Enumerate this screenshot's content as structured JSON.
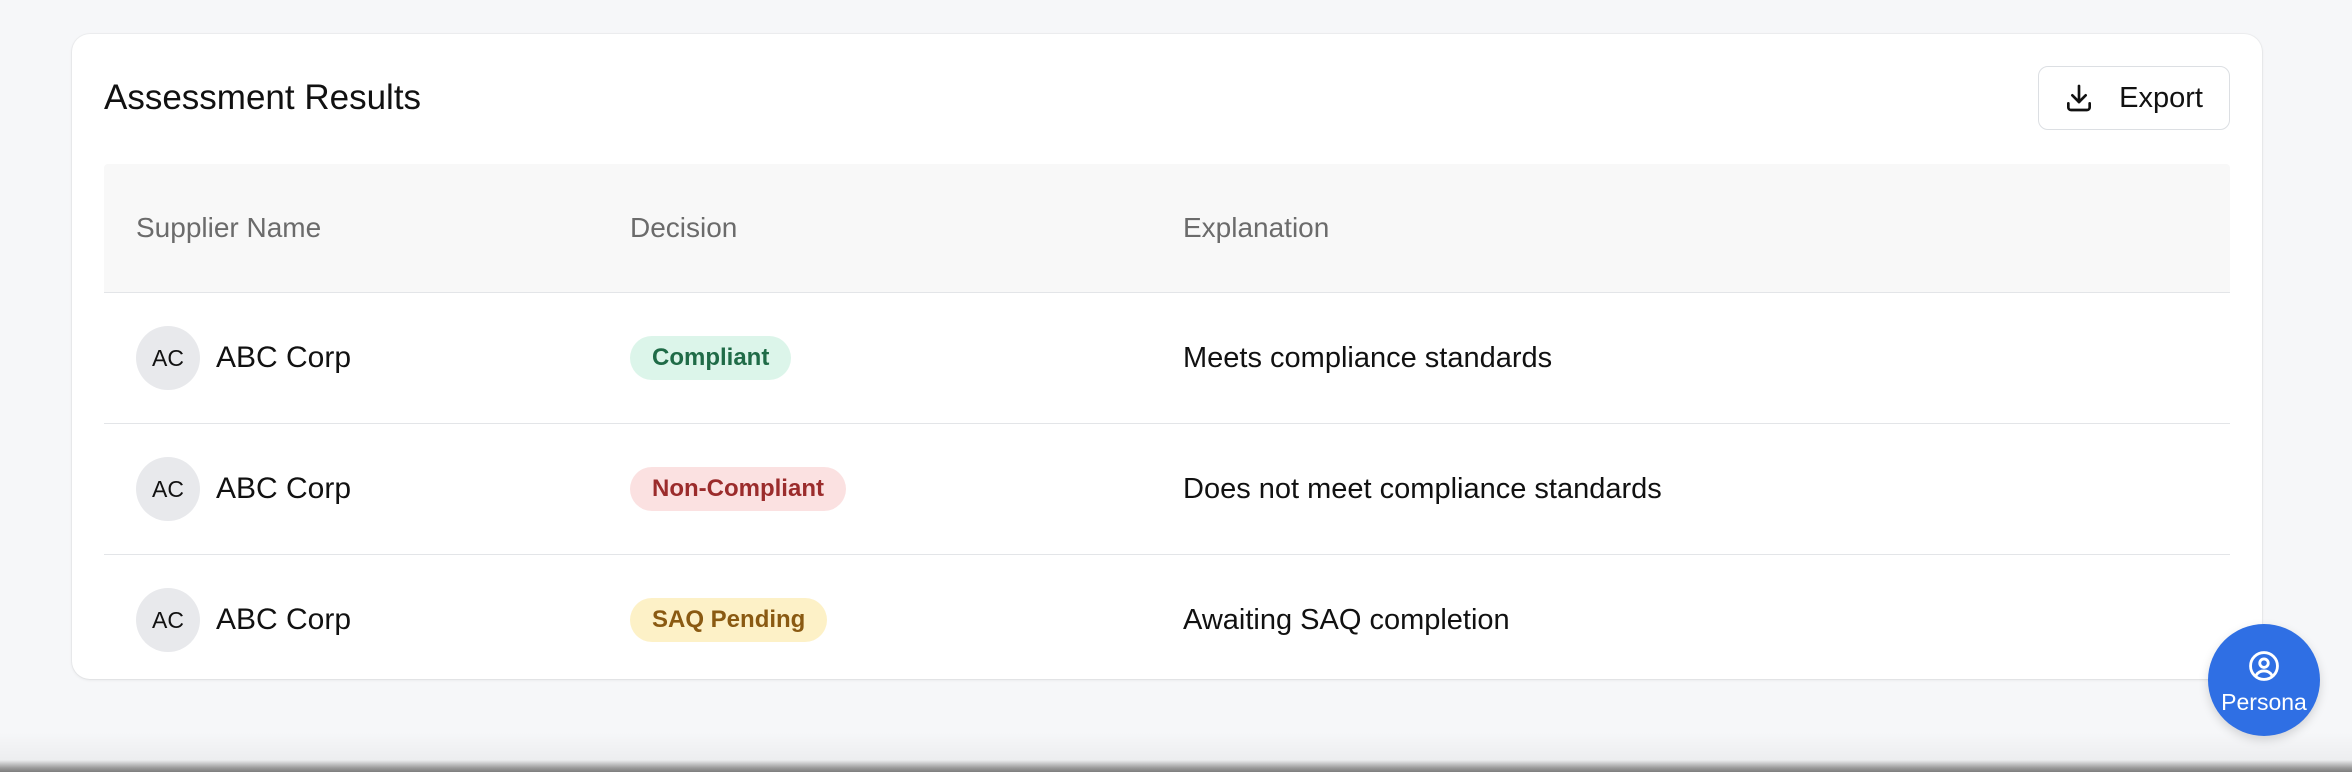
{
  "card": {
    "title": "Assessment Results",
    "export_label": "Export"
  },
  "table": {
    "headers": [
      "Supplier Name",
      "Decision",
      "Explanation"
    ],
    "rows": [
      {
        "avatar": "AC",
        "supplier": "ABC Corp",
        "decision": "Compliant",
        "decision_status": "compliant",
        "explanation": "Meets compliance standards"
      },
      {
        "avatar": "AC",
        "supplier": "ABC Corp",
        "decision": "Non-Compliant",
        "decision_status": "non-compliant",
        "explanation": "Does not meet compliance standards"
      },
      {
        "avatar": "AC",
        "supplier": "ABC Corp",
        "decision": "SAQ Pending",
        "decision_status": "pending",
        "explanation": "Awaiting SAQ completion"
      }
    ]
  },
  "badge_colors": {
    "compliant": {
      "bg": "#dcf5ea",
      "fg": "#1f6b47"
    },
    "non-compliant": {
      "bg": "#fbe1e1",
      "fg": "#9b2c2c"
    },
    "pending": {
      "bg": "#fdf1c7",
      "fg": "#8a5a12"
    }
  },
  "persona": {
    "label": "Persona",
    "icon": "user-circle-icon",
    "color": "#2f6fe4"
  },
  "icons": {
    "export": "download-icon"
  }
}
